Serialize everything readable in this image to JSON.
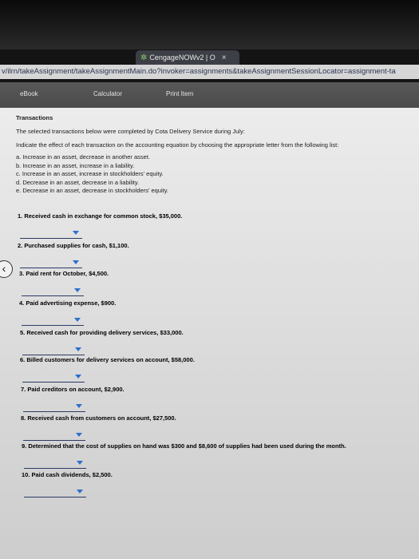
{
  "browser": {
    "tab_title": "CengageNOWv2 | O",
    "tab_close": "×",
    "url": "v/ilrn/takeAssignment/takeAssignmentMain.do?invoker=assignments&takeAssignmentSessionLocator=assignment-ta"
  },
  "toolbar": {
    "ebook": "eBook",
    "calculator": "Calculator",
    "print": "Print Item"
  },
  "content": {
    "title": "Transactions",
    "intro": "The selected transactions below were completed by Cota Delivery Service during July:",
    "instruction": "Indicate the effect of each transaction on the accounting equation by choosing the appropriate letter from the following list:",
    "options": [
      "a. Increase in an asset, decrease in another asset.",
      "b. Increase in an asset, increase in a liability.",
      "c. Increase in an asset, increase in stockholders' equity.",
      "d. Decrease in an asset, decrease in a liability.",
      "e. Decrease in an asset, decrease in stockholders' equity."
    ],
    "questions": [
      "1. Received cash in exchange for common stock, $35,000.",
      "2. Purchased supplies for cash, $1,100.",
      "3. Paid rent for October, $4,500.",
      "4. Paid advertising expense, $900.",
      "5. Received cash for providing delivery services, $33,000.",
      "6. Billed customers for delivery services on account, $58,000.",
      "7. Paid creditors on account, $2,900.",
      "8. Received cash from customers on account, $27,500.",
      "9. Determined that the cost of supplies on hand was $300 and $8,600 of supplies had been used during the month.",
      "10. Paid cash dividends, $2,500."
    ]
  }
}
